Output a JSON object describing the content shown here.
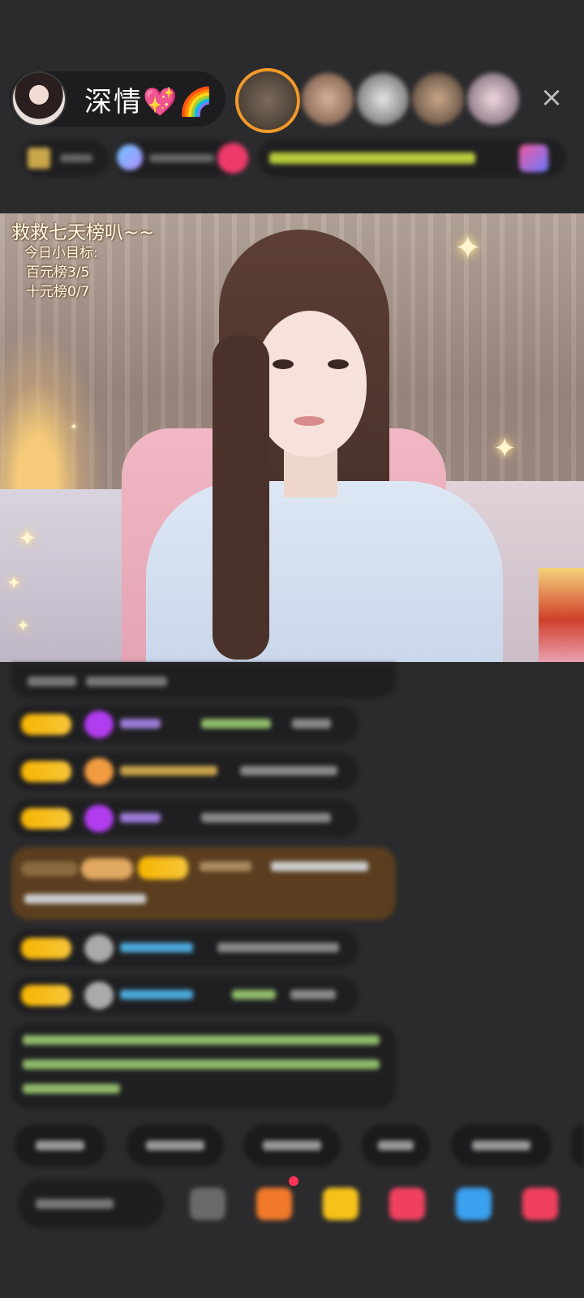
{
  "host": {
    "name": "深情💖🌈"
  },
  "stream_overlay": {
    "title": "救救七天榜叭~~",
    "subtitle": "今日小目标:",
    "goal_1": "百元榜3/5",
    "goal_2": "十元榜0/7"
  },
  "colors": {
    "background": "#2b2b2d",
    "pill": "#1d1d1f",
    "badge_yellow": "#f7b400",
    "highlight_msg": "#5a3e1f"
  },
  "icons": {
    "close": "×",
    "star": "✦"
  }
}
